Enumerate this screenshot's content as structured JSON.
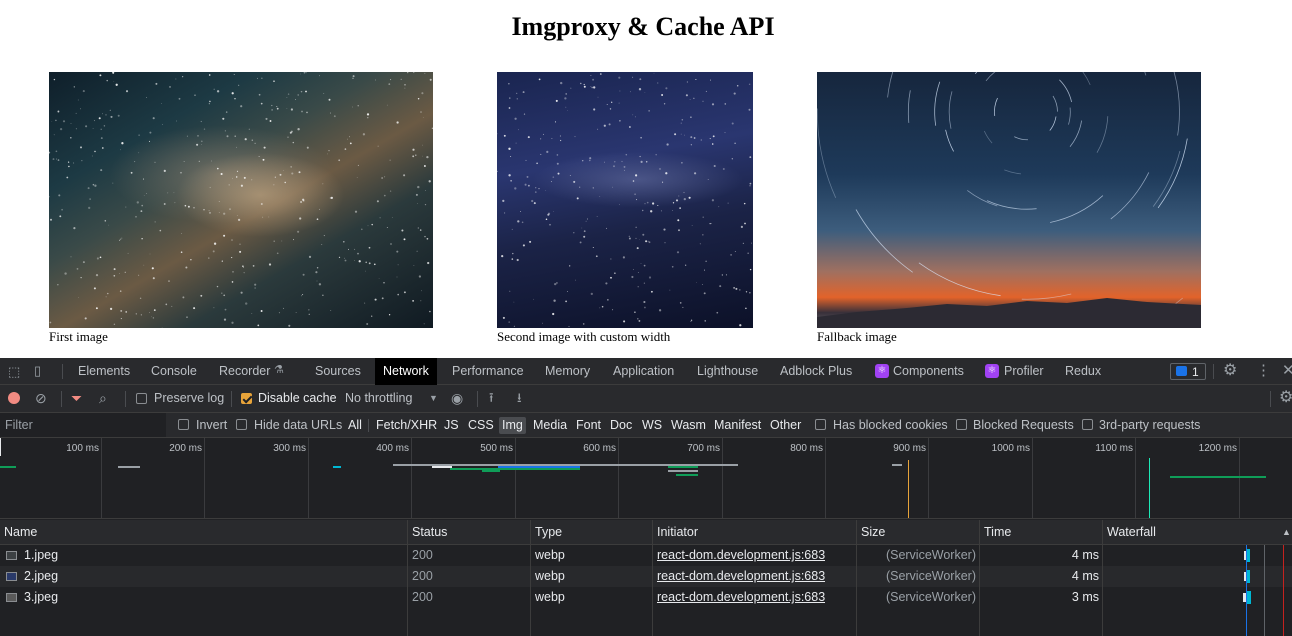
{
  "page": {
    "title": "Imgproxy & Cache API",
    "images": [
      {
        "caption": "First image"
      },
      {
        "caption": "Second image with custom width"
      },
      {
        "caption": "Fallback image"
      }
    ]
  },
  "devtools": {
    "tabs": [
      "Elements",
      "Console",
      "Recorder",
      "Sources",
      "Network",
      "Performance",
      "Memory",
      "Application",
      "Lighthouse",
      "Adblock Plus",
      "Components",
      "Profiler",
      "Redux"
    ],
    "active_tab": "Network",
    "issues_count": "1",
    "toolbar": {
      "preserve_log": "Preserve log",
      "disable_cache": "Disable cache",
      "throttling": "No throttling"
    },
    "filter": {
      "placeholder": "Filter",
      "invert": "Invert",
      "hide_data_urls": "Hide data URLs",
      "types": [
        "All",
        "Fetch/XHR",
        "JS",
        "CSS",
        "Img",
        "Media",
        "Font",
        "Doc",
        "WS",
        "Wasm",
        "Manifest",
        "Other"
      ],
      "selected_type": "Img",
      "has_blocked_cookies": "Has blocked cookies",
      "blocked_requests": "Blocked Requests",
      "third_party": "3rd-party requests"
    },
    "timeline_ticks": [
      "100 ms",
      "200 ms",
      "300 ms",
      "400 ms",
      "500 ms",
      "600 ms",
      "700 ms",
      "800 ms",
      "900 ms",
      "1000 ms",
      "1100 ms",
      "1200 ms"
    ],
    "table": {
      "columns": [
        "Name",
        "Status",
        "Type",
        "Initiator",
        "Size",
        "Time",
        "Waterfall"
      ],
      "rows": [
        {
          "name": "1.jpeg",
          "status": "200",
          "type": "webp",
          "initiator": "react-dom.development.js:683",
          "size": "(ServiceWorker)",
          "time": "4 ms"
        },
        {
          "name": "2.jpeg",
          "status": "200",
          "type": "webp",
          "initiator": "react-dom.development.js:683",
          "size": "(ServiceWorker)",
          "time": "4 ms"
        },
        {
          "name": "3.jpeg",
          "status": "200",
          "type": "webp",
          "initiator": "react-dom.development.js:683",
          "size": "(ServiceWorker)",
          "time": "3 ms"
        }
      ]
    },
    "colors": {
      "accent": "#e8a43a",
      "record": "#f28b82",
      "filter_icon": "#f28b82"
    }
  }
}
